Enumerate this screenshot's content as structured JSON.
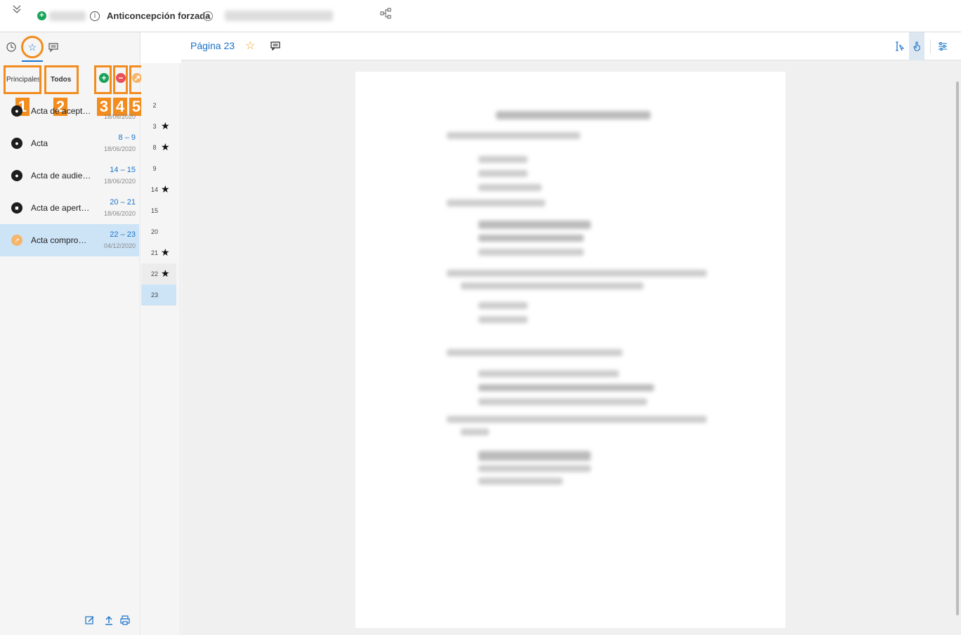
{
  "topbar": {
    "title": "Anticoncepción forzada"
  },
  "sidebar": {
    "subtabs": [
      "Principales",
      "Todos"
    ],
    "badges": [
      "1",
      "2",
      "3",
      "4",
      "5"
    ],
    "documents": [
      {
        "name": "Acta de acept…",
        "pages": "",
        "date": "18/06/2020"
      },
      {
        "name": "Acta",
        "pages": "8 – 9",
        "date": "18/06/2020"
      },
      {
        "name": "Acta de audie…",
        "pages": "14 – 15",
        "date": "18/06/2020"
      },
      {
        "name": "Acta de apert…",
        "pages": "20 – 21",
        "date": "18/06/2020"
      },
      {
        "name": "Acta compro…",
        "pages": "22 – 23",
        "date": "04/12/2020"
      }
    ]
  },
  "page_list": [
    {
      "num": "2",
      "star": false
    },
    {
      "num": "3",
      "star": true
    },
    {
      "num": "8",
      "star": true
    },
    {
      "num": "9",
      "star": false
    },
    {
      "num": "14",
      "star": true
    },
    {
      "num": "15",
      "star": false
    },
    {
      "num": "20",
      "star": false
    },
    {
      "num": "21",
      "star": true
    },
    {
      "num": "22",
      "star": true
    },
    {
      "num": "23",
      "star": false
    }
  ],
  "viewer": {
    "page_title": "Página 23"
  },
  "colors": {
    "accent": "#1a73c8",
    "highlight": "#f28c1e",
    "add": "#1aa35a",
    "remove": "#e8505b"
  }
}
